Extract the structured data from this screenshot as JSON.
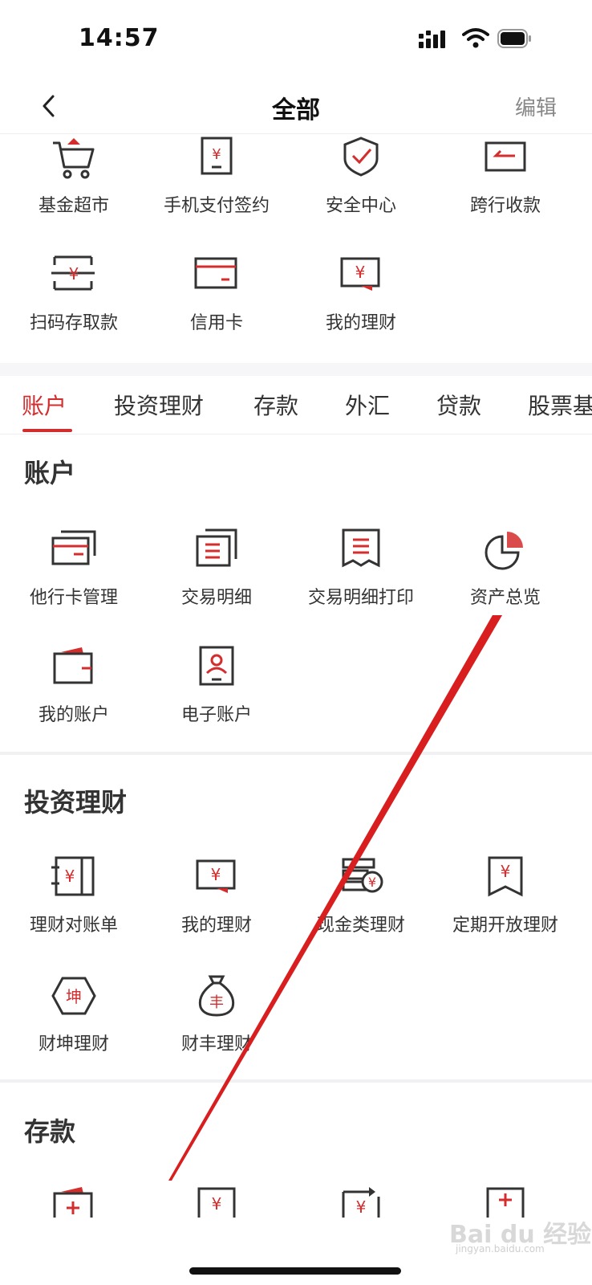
{
  "status": {
    "time": "14:57"
  },
  "nav": {
    "title": "全部",
    "edit": "编辑"
  },
  "top_items": [
    {
      "label": "基金超市",
      "icon": "cart-icon"
    },
    {
      "label": "手机支付签约",
      "icon": "phone-yen-icon"
    },
    {
      "label": "安全中心",
      "icon": "shield-icon"
    },
    {
      "label": "跨行收款",
      "icon": "card-arrow-icon"
    },
    {
      "label": "扫码存取款",
      "icon": "scan-yen-icon"
    },
    {
      "label": "信用卡",
      "icon": "credit-card-icon"
    },
    {
      "label": "我的理财",
      "icon": "yen-screen-icon"
    }
  ],
  "tabs": [
    "账户",
    "投资理财",
    "存款",
    "外汇",
    "贷款",
    "股票基金"
  ],
  "sections": [
    {
      "title": "账户",
      "items": [
        {
          "label": "他行卡管理",
          "icon": "cards-stack-icon"
        },
        {
          "label": "交易明细",
          "icon": "doc-stack-icon"
        },
        {
          "label": "交易明细打印",
          "icon": "receipt-icon"
        },
        {
          "label": "资产总览",
          "icon": "pie-chart-icon"
        },
        {
          "label": "我的账户",
          "icon": "wallet-icon"
        },
        {
          "label": "电子账户",
          "icon": "id-card-icon"
        }
      ]
    },
    {
      "title": "投资理财",
      "items": [
        {
          "label": "理财对账单",
          "icon": "yen-book-icon"
        },
        {
          "label": "我的理财",
          "icon": "yen-screen-icon"
        },
        {
          "label": "现金类理财",
          "icon": "coin-stack-icon"
        },
        {
          "label": "定期开放理财",
          "icon": "yen-bookmark-icon"
        },
        {
          "label": "财坤理财",
          "icon": "hexagon-kun-icon"
        },
        {
          "label": "财丰理财",
          "icon": "money-bag-icon"
        }
      ]
    },
    {
      "title": "存款",
      "items": [
        {
          "label": "",
          "icon": "plus-box-icon"
        },
        {
          "label": "",
          "icon": "yen-box-icon"
        },
        {
          "label": "",
          "icon": "yen-loop-icon"
        },
        {
          "label": "",
          "icon": "plus-doc-icon"
        }
      ]
    }
  ],
  "icon_text": {
    "kun": "坤",
    "feng": "丰",
    "yen": "¥"
  },
  "watermark": {
    "main": "Bai du 经验",
    "sub": "jingyan.baidu.com"
  },
  "colors": {
    "accent": "#d42d2d",
    "icon_stroke": "#333333",
    "text": "#333333"
  }
}
